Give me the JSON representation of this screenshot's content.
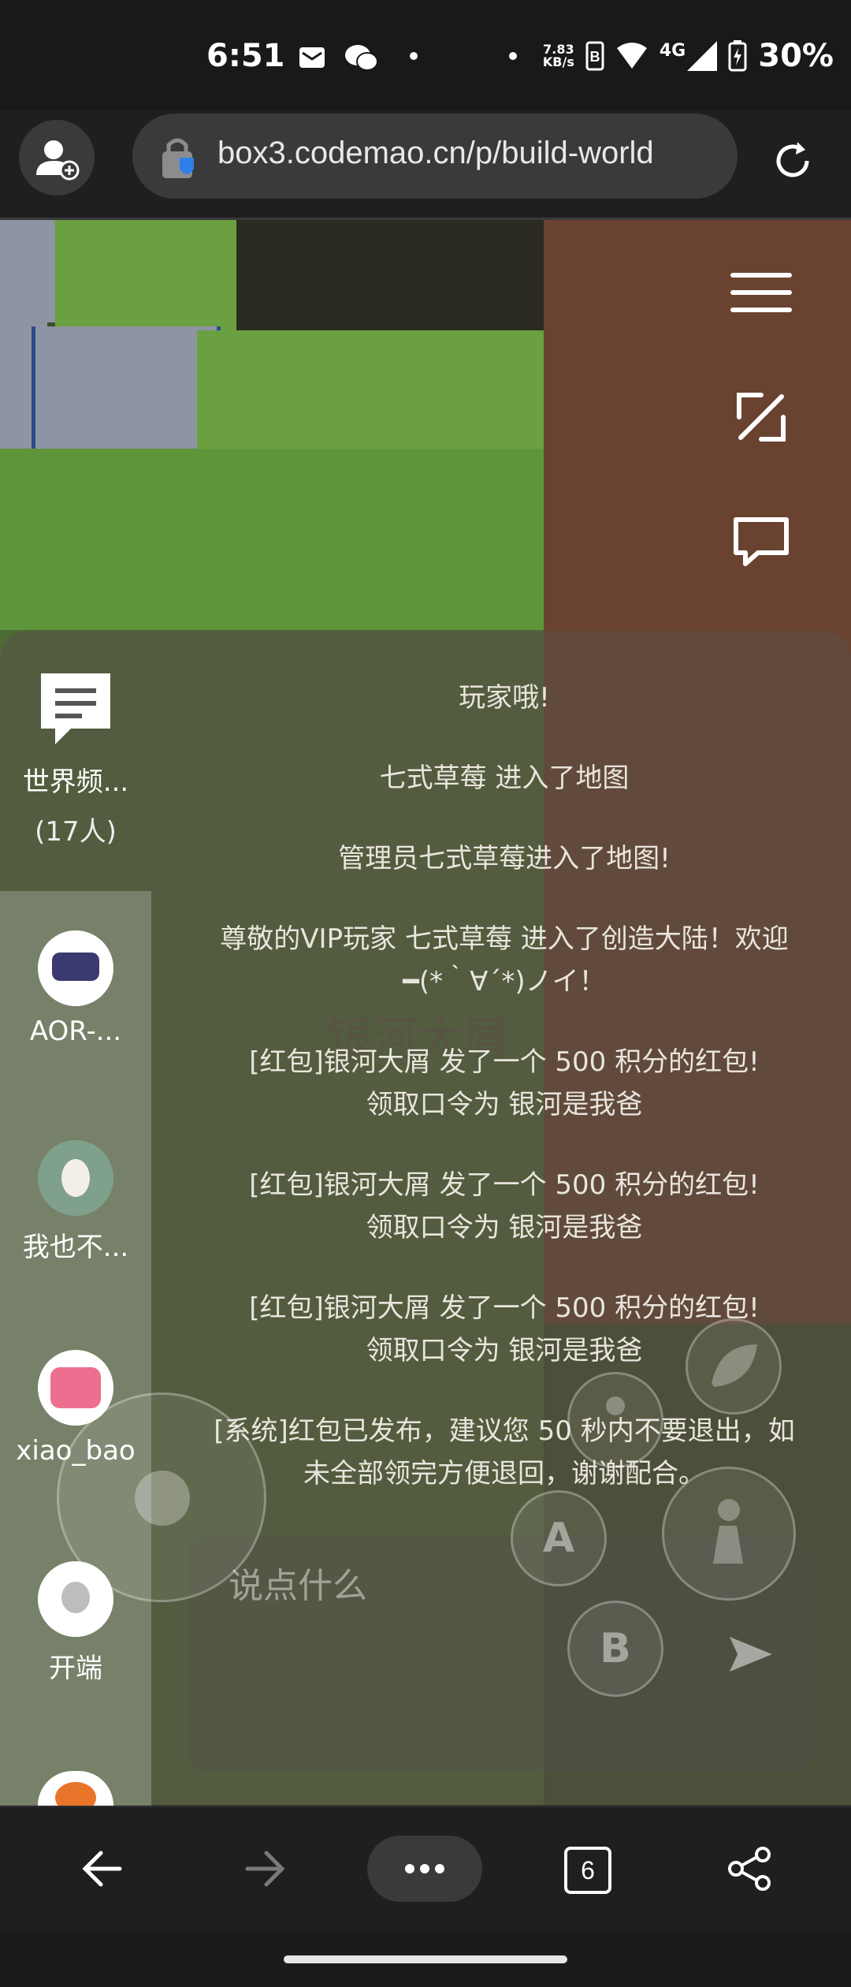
{
  "status_bar": {
    "time": "6:51",
    "net_speed_value": "7.83",
    "net_speed_unit": "KB/s",
    "network": "4G",
    "battery": "30%"
  },
  "browser": {
    "url": "box3.codemao.cn/p/build-world"
  },
  "world_channel": {
    "label": "世界频...",
    "count": "(17人)"
  },
  "players": [
    {
      "name": "AOR-..."
    },
    {
      "name": "我也不..."
    },
    {
      "name": "xiao_bao"
    },
    {
      "name": "开端"
    }
  ],
  "chat_messages": [
    "玩家哦!",
    "七式草莓 进入了地图",
    "管理员七式草莓进入了地图!",
    "尊敬的VIP玩家 七式草莓 进入了创造大陆！欢迎",
    "━(*｀∀´*)ノイ！",
    "[红包]银河大屑 发了一个 500 积分的红包!",
    "领取口令为 银河是我爸",
    "[红包]银河大屑 发了一个 500 积分的红包!",
    "领取口令为 银河是我爸",
    "[红包]银河大屑 发了一个 500 积分的红包!",
    "领取口令为 银河是我爸",
    "[系统]红包已发布，建议您 50 秒内不要退出，如",
    "未全部领完方便退回，谢谢配合。"
  ],
  "overlay_name": "银河大屑",
  "chat_input": {
    "placeholder": "说点什么"
  },
  "controls": {
    "a_label": "A",
    "b_label": "B"
  },
  "nav": {
    "tab_count": "6"
  }
}
